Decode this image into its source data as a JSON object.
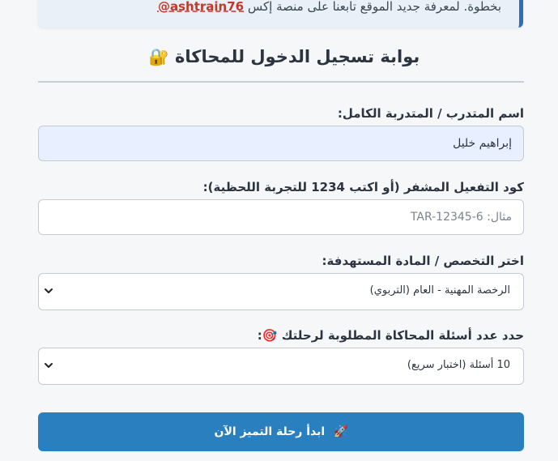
{
  "notice": {
    "text": "بخطوة. لمعرفة جديد الموقع تابعنا على منصة إكس",
    "handle": "ashtrain76@"
  },
  "login_card": {
    "title": "بوابة تسجيل الدخول للمحاكاة",
    "title_icon": "🔐",
    "name_label": "اسم المتدرب / المتدربة الكامل:",
    "name_value": "إبراهيم خليل",
    "code_label": "كود التفعيل المشفر (أو اكتب 1234 للتجربة اللحظية):",
    "code_placeholder": "مثال: TAR-12345-6",
    "specialty_label": "اختر التخصص / المادة المستهدفة:",
    "specialty_value": "الرخصة المهنية - العام (التربوي)",
    "count_label": "حدد عدد أسئلة المحاكاة المطلوبة لرحلتك",
    "count_icon": "🎯",
    "count_value": "10 أسئلة (اختبار سريع)",
    "start_button": "ابدأ رحلة التميز الآن",
    "start_icon": "🚀"
  },
  "colors": {
    "accent": "#2a7fbf",
    "notice_border": "#2f6fb6",
    "handle": "#c0392b",
    "filled_input_bg": "#e8efff"
  }
}
